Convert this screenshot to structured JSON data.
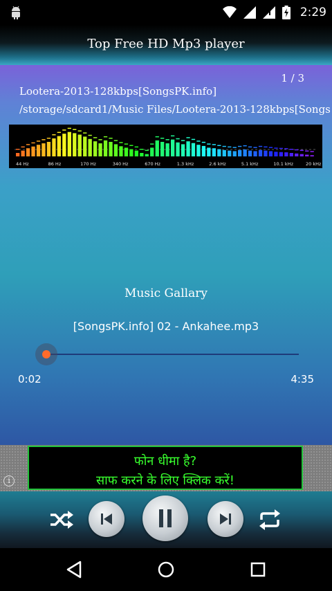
{
  "status_bar": {
    "time": "2:29",
    "icons": [
      "android-icon",
      "wifi-icon",
      "signal-icon",
      "signal-icon",
      "battery-charging-icon"
    ]
  },
  "app": {
    "title": "Top Free HD Mp3 player"
  },
  "playlist": {
    "counter": "1 / 3",
    "file_name": "Lootera-2013-128kbps[SongsPK.info]",
    "file_path": "/storage/sdcard1/Music Files/Lootera-2013-128kbps[Songs..."
  },
  "visualizer": {
    "frequency_labels": [
      "44 Hz",
      "86 Hz",
      "170 Hz",
      "340 Hz",
      "670 Hz",
      "1.3 kHz",
      "2.6 kHz",
      "5.1 kHz",
      "10.1 kHz",
      "20 kHz"
    ],
    "levels": [
      0.12,
      0.2,
      0.28,
      0.34,
      0.4,
      0.45,
      0.5,
      0.62,
      0.7,
      0.78,
      0.84,
      0.8,
      0.75,
      0.68,
      0.6,
      0.52,
      0.45,
      0.55,
      0.5,
      0.42,
      0.35,
      0.3,
      0.25,
      0.2,
      0.12,
      0.08,
      0.3,
      0.55,
      0.5,
      0.45,
      0.58,
      0.48,
      0.42,
      0.52,
      0.46,
      0.4,
      0.36,
      0.3,
      0.28,
      0.25,
      0.22,
      0.2,
      0.18,
      0.22,
      0.24,
      0.2,
      0.18,
      0.22,
      0.2,
      0.18,
      0.16,
      0.15,
      0.14,
      0.12,
      0.1,
      0.08,
      0.06,
      0.04
    ]
  },
  "now_playing": {
    "gallery_label": "Music Gallary",
    "song_title": "[SongsPK.info] 02 - Ankahee.mp3",
    "elapsed": "0:02",
    "duration": "4:35",
    "progress": 0.007
  },
  "ad": {
    "line1": "फोन धीमा है?",
    "line2": "साफ करने के लिए क्लिक करें!",
    "info_glyph": "i"
  },
  "controls": [
    "shuffle-icon",
    "previous-icon",
    "pause-icon",
    "next-icon",
    "repeat-icon"
  ],
  "nav": [
    "back-icon",
    "home-icon",
    "recents-icon"
  ],
  "colors": {
    "accent_thumb": "#ff6b2b",
    "ad_text": "#38ff2e",
    "seek_track": "#1e3b7a"
  }
}
